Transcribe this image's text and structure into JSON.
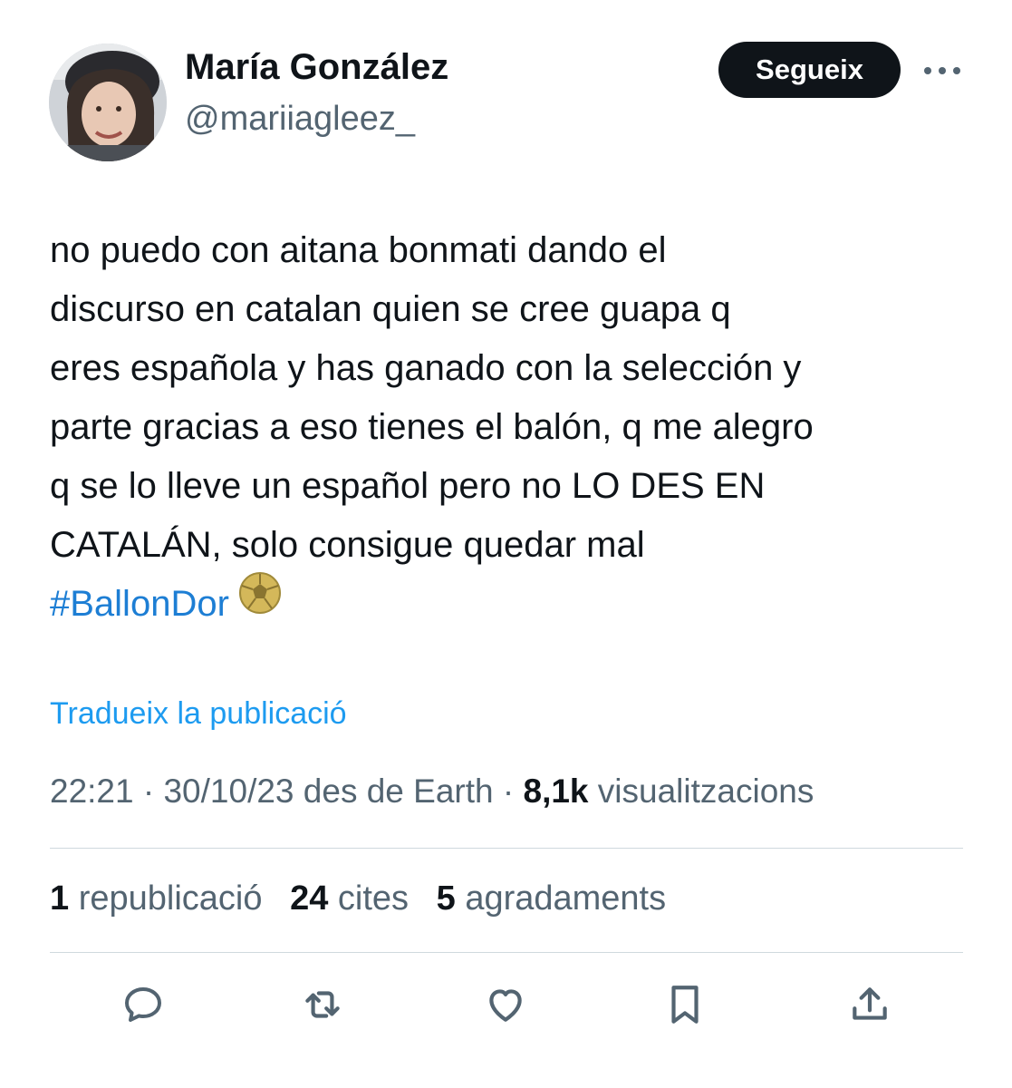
{
  "author": {
    "name": "María González",
    "handle": "@mariiagleez_"
  },
  "header": {
    "follow_label": "Segueix",
    "more_icon": "more-horizontal-icon"
  },
  "tweet": {
    "lines": [
      "no puedo con aitana bonmati dando el",
      "discurso en catalan quien se cree guapa q",
      "eres española y has ganado con la selección y",
      "parte gracias a eso tienes el balón, q me alegro",
      "q se lo lleve un español pero no LO DES EN",
      "CATALÁN, solo consigue quedar mal"
    ],
    "hashtag": "#BallonDor",
    "hashtag_icon": "golden-ball-icon"
  },
  "translate_label": "Tradueix la publicació",
  "meta": {
    "time": "22:21",
    "date": "30/10/23",
    "source": "des de Earth",
    "views_count": "8,1k",
    "views_label": "visualitzacions"
  },
  "stats": {
    "reposts_count": "1",
    "reposts_label": "republicació",
    "quotes_count": "24",
    "quotes_label": "cites",
    "likes_count": "5",
    "likes_label": "agradaments"
  },
  "actions": [
    "reply-icon",
    "repost-icon",
    "like-icon",
    "bookmark-icon",
    "share-icon"
  ],
  "colors": {
    "text": "#0f1419",
    "secondary": "#536471",
    "link": "#1d9bf0",
    "button_bg": "#0f1419",
    "divider": "#cfd9de"
  }
}
